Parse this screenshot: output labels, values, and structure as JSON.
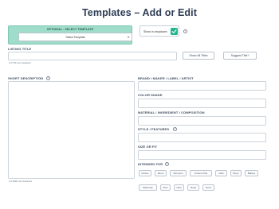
{
  "page": {
    "title": "Templates – Add or Edit"
  },
  "template_selector": {
    "title": "OPTIONAL - SELECT TEMPLATE",
    "selected": "Select Template"
  },
  "show_in_dropdown": {
    "label": "Show in dropdown",
    "checked": true
  },
  "listing_title": {
    "label": "LISTING TITLE",
    "value": "",
    "hint": "0 of 750 max characters",
    "show_all_button": "Show All Titles",
    "suggest_button": "Suggest Title?"
  },
  "short_description": {
    "label": "SHORT DESCRIPTION",
    "value": "",
    "hint": "0 of 5000 max characters"
  },
  "right_fields": [
    {
      "label": "BRAND / MAKER / LABEL / ARTIST",
      "value": ""
    },
    {
      "label": "COLOR SHADE",
      "value": ""
    },
    {
      "label": "MATERIAL / INGREDIENT / COMPOSITION",
      "value": ""
    },
    {
      "label": "STYLE / FEATURES",
      "value": ""
    },
    {
      "label": "SIZE OR FIT",
      "value": ""
    }
  ],
  "intended_for": {
    "label": "INTENDED FOR",
    "options_row1": [
      "Unisex",
      "Mens",
      "Womens",
      "Unisex Kids",
      "Girls",
      "Boys",
      "Babies"
    ],
    "options_row2": [
      "Maternity",
      "Pets",
      "Cats",
      "Dogs",
      "None"
    ]
  },
  "colors": {
    "accent": "#20b58e",
    "template_bg": "#9fdcc9",
    "title": "#2e3d55"
  },
  "icons": {
    "info": "info-circle-icon",
    "check": "check-icon",
    "caret": "chevron-down-icon"
  }
}
